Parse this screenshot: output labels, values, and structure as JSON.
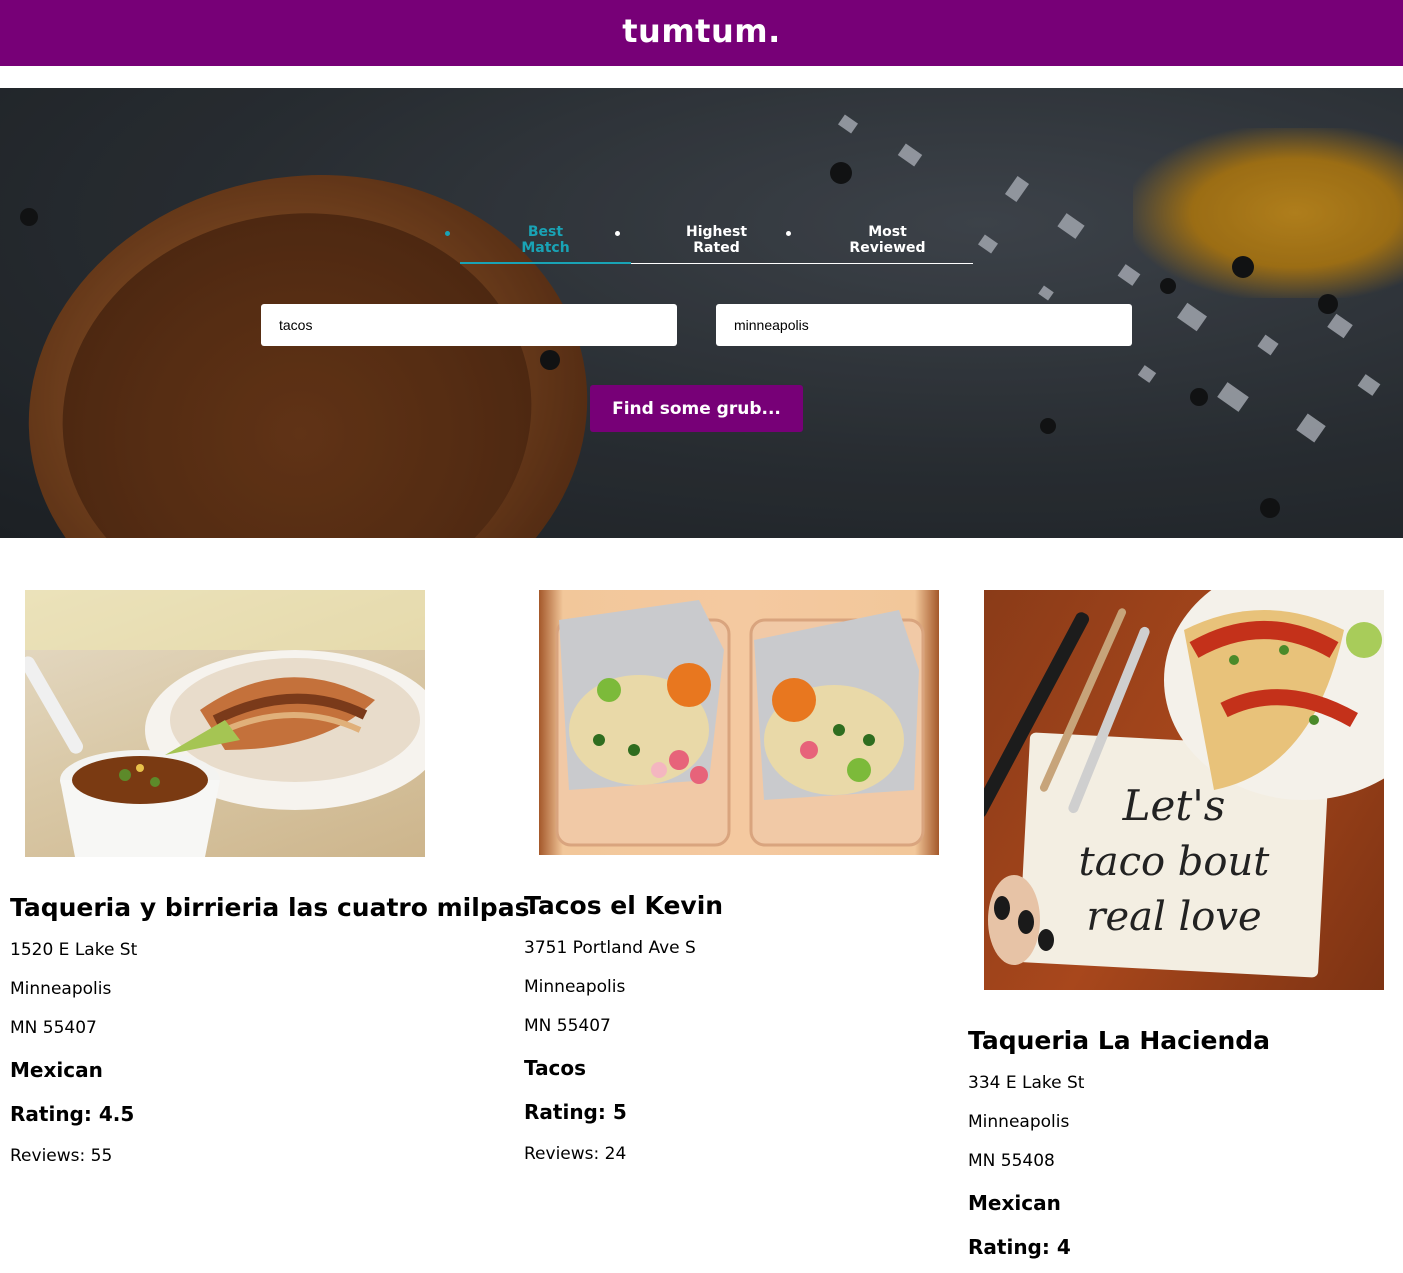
{
  "header": {
    "logo": "tumtum."
  },
  "search": {
    "sort_tabs": [
      {
        "label_line1": "Best",
        "label_line2": "Match",
        "active": true
      },
      {
        "label_line1": "Highest",
        "label_line2": "Rated",
        "active": false
      },
      {
        "label_line1": "Most",
        "label_line2": "Reviewed",
        "active": false
      }
    ],
    "term_value": "tacos",
    "location_value": "minneapolis",
    "submit_label": "Find some grub..."
  },
  "colors": {
    "brand": "#770077",
    "active_tab": "#19a3b5"
  },
  "results": [
    {
      "name": "Taqueria y birrieria las cuatro milpas",
      "address": "1520 E Lake St",
      "city": "Minneapolis",
      "state_zip": "MN 55407",
      "category": "Mexican",
      "rating": "Rating: 4.5",
      "reviews": "Reviews: 55",
      "image_icon": "birria-tacos-photo"
    },
    {
      "name": "Tacos el Kevin",
      "address": "3751 Portland Ave S",
      "city": "Minneapolis",
      "state_zip": "MN 55407",
      "category": "Tacos",
      "rating": "Rating: 5",
      "reviews": "Reviews: 24",
      "image_icon": "tacos-takeout-photo"
    },
    {
      "name": "Taqueria La Hacienda",
      "address": "334 E Lake St",
      "city": "Minneapolis",
      "state_zip": "MN 55408",
      "category": "Mexican",
      "rating": "Rating: 4",
      "image_icon": "tacos-notebook-photo",
      "image_text": "Let's taco bout real love"
    }
  ]
}
